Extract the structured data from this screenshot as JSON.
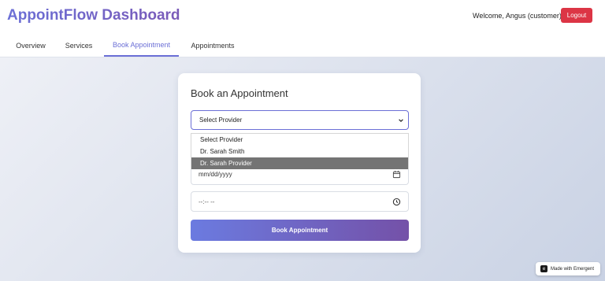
{
  "header": {
    "title": "AppointFlow Dashboard",
    "welcome": "Welcome, Angus (customer)",
    "logout_label": "Logout"
  },
  "tabs": [
    {
      "label": "Overview"
    },
    {
      "label": "Services"
    },
    {
      "label": "Book Appointment",
      "active": true
    },
    {
      "label": "Appointments"
    }
  ],
  "card": {
    "title": "Book an Appointment",
    "provider_select": {
      "value": "Select Provider",
      "options": [
        "Select Provider",
        "Dr. Sarah Smith",
        "Dr. Sarah Provider"
      ],
      "highlighted": "Dr. Sarah Provider"
    },
    "date_placeholder": "mm/dd/yyyy",
    "time_placeholder": "--:-- --",
    "submit_label": "Book Appointment"
  },
  "badge": {
    "label": "Made with Emergent"
  },
  "colors": {
    "accent": "#6b6fd6",
    "logout": "#dc3545",
    "button_start": "#6b7be0",
    "button_end": "#7451a8"
  },
  "icons": {
    "date": "calendar-icon",
    "time": "clock-icon",
    "select": "chevron-down-icon"
  }
}
